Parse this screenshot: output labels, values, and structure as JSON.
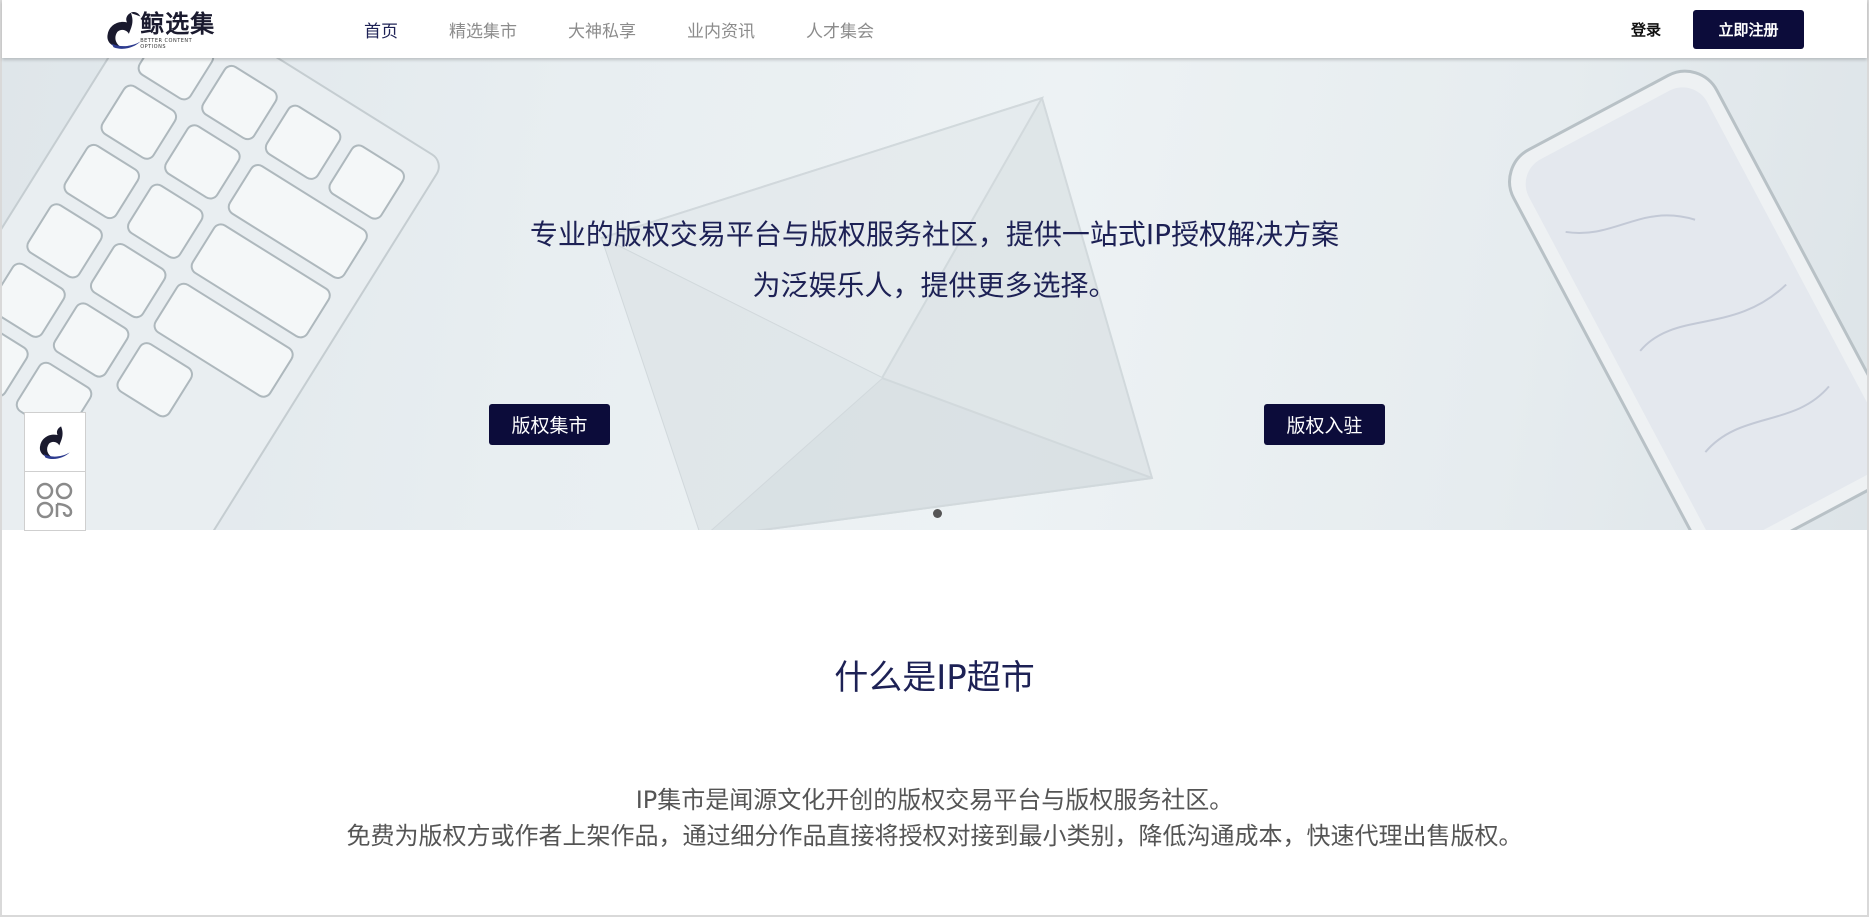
{
  "header": {
    "logo": {
      "name": "鲸选集",
      "subtitle": "BETTER CONTENT OPTIONS"
    },
    "nav": [
      {
        "label": "首页",
        "active": true
      },
      {
        "label": "精选集市",
        "active": false
      },
      {
        "label": "大神私享",
        "active": false
      },
      {
        "label": "业内资讯",
        "active": false
      },
      {
        "label": "人才集会",
        "active": false
      }
    ],
    "login_label": "登录",
    "register_label": "立即注册"
  },
  "hero": {
    "line1": "专业的版权交易平台与版权服务社区，提供一站式IP授权解决方案",
    "line2": "为泛娱乐人，提供更多选择。",
    "button_left": "版权集市",
    "button_right": "版权入驻",
    "carousel_dots": 1
  },
  "side_tools": [
    {
      "icon": "whale-logo-icon"
    },
    {
      "icon": "app-grid-icon"
    }
  ],
  "about": {
    "title": "什么是IP超市",
    "p1": "IP集市是闻源文化开创的版权交易平台与版权服务社区。",
    "p2": "免费为版权方或作者上架作品，通过细分作品直接将授权对接到最小类别，降低沟通成本，快速代理出售版权。"
  },
  "colors": {
    "primary": "#0c0c3a",
    "heading": "#1d2155",
    "nav_inactive": "#8c8c8c"
  }
}
